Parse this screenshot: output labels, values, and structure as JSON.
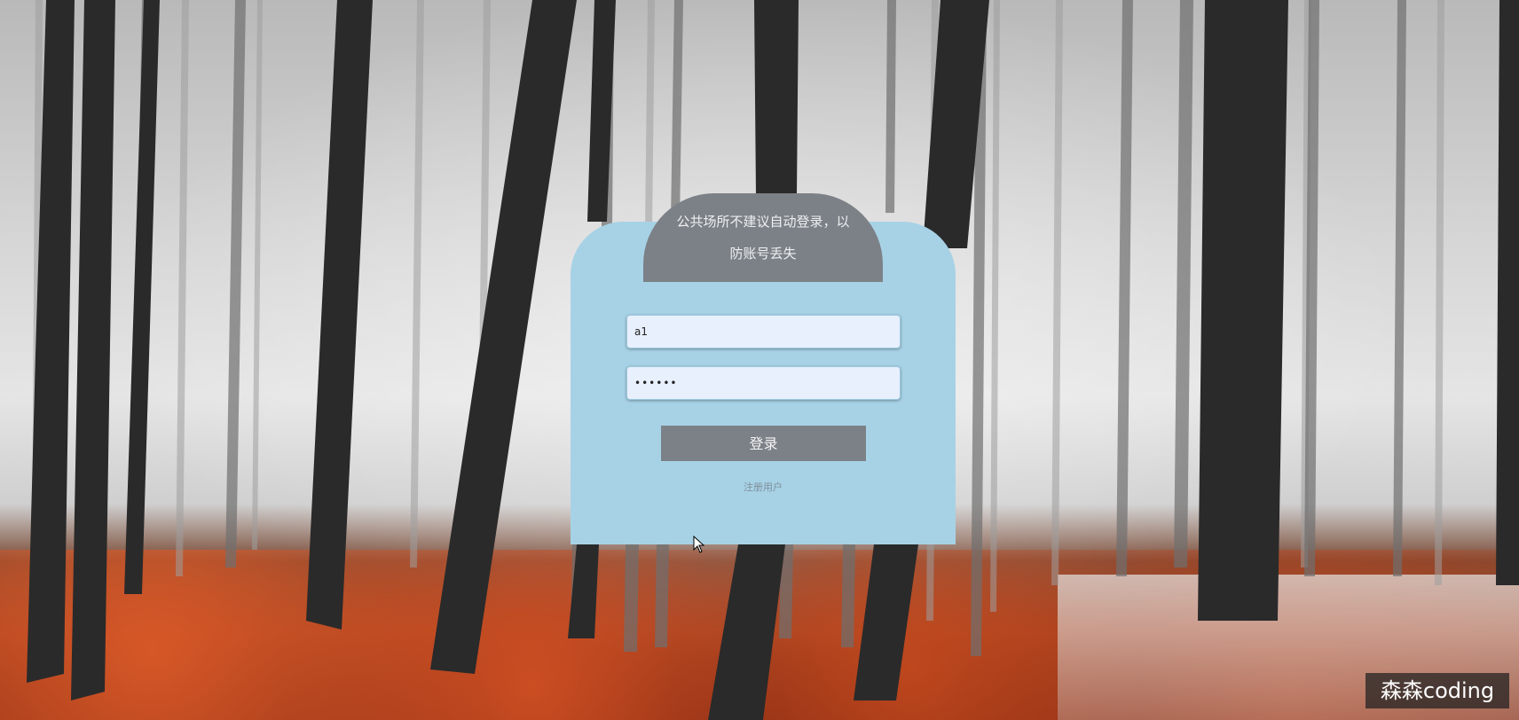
{
  "login": {
    "notice_text": "公共场所不建议自动登录，以防账号丢失",
    "username_value": "a1",
    "password_value": "••••••",
    "login_button_label": "登录",
    "register_link_label": "注册用户"
  },
  "colors": {
    "panel_background": "#a7d2e6",
    "cap_and_button": "#7c8187",
    "input_background": "#e8f0fe"
  },
  "watermark": {
    "text": "森森coding"
  },
  "icons": {
    "cursor": "mouse-pointer-icon"
  }
}
